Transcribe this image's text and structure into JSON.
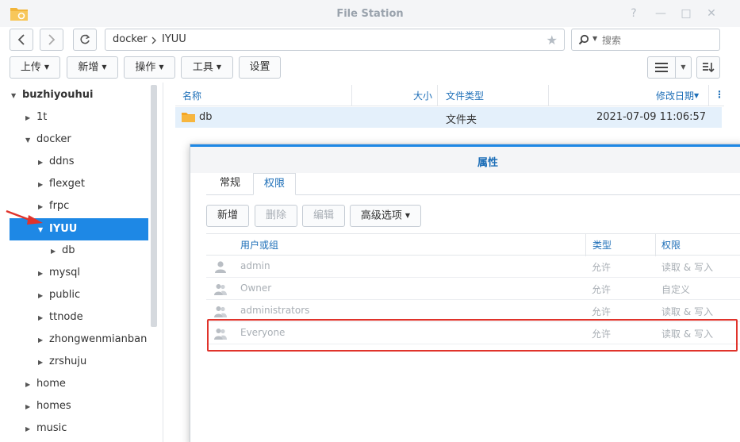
{
  "window": {
    "title": "File Station",
    "controls": [
      "?",
      "—",
      "□",
      "✕"
    ]
  },
  "path": {
    "segments": [
      "docker",
      "IYUU"
    ]
  },
  "search": {
    "placeholder": "搜索"
  },
  "toolbar": {
    "upload": "上传",
    "new": "新增",
    "action": "操作",
    "tools": "工具",
    "settings": "设置"
  },
  "tree": {
    "root": "buzhiyouhui",
    "items": [
      {
        "label": "1t"
      },
      {
        "label": "docker"
      },
      {
        "label": "ddns"
      },
      {
        "label": "flexget"
      },
      {
        "label": "frpc"
      },
      {
        "label": "IYUU"
      },
      {
        "label": "db"
      },
      {
        "label": "mysql"
      },
      {
        "label": "public"
      },
      {
        "label": "ttnode"
      },
      {
        "label": "zhongwenmianban"
      },
      {
        "label": "zrshuju"
      },
      {
        "label": "home"
      },
      {
        "label": "homes"
      },
      {
        "label": "music"
      }
    ]
  },
  "file_list": {
    "columns": {
      "name": "名称",
      "size": "大小",
      "type": "文件类型",
      "modified": "修改日期"
    },
    "rows": [
      {
        "name": "db",
        "size": "",
        "type": "文件夹",
        "modified": "2021-07-09 11:06:57"
      }
    ]
  },
  "dialog": {
    "title": "属性",
    "tabs": [
      "常规",
      "权限"
    ],
    "active_tab": "权限",
    "buttons": {
      "add": "新增",
      "delete": "删除",
      "edit": "编辑",
      "advanced": "高级选项"
    },
    "columns": {
      "user": "用户或组",
      "type": "类型",
      "permission": "权限"
    },
    "rows": [
      {
        "user": "admin",
        "type": "允许",
        "permission": "读取 & 写入"
      },
      {
        "user": "Owner",
        "type": "允许",
        "permission": "自定义"
      },
      {
        "user": "administrators",
        "type": "允许",
        "permission": "读取 & 写入"
      },
      {
        "user": "Everyone",
        "type": "允许",
        "permission": "读取 & 写入"
      }
    ]
  },
  "colors": {
    "accent": "#1e88e5",
    "highlight": "#e0332b",
    "folder": "#f5a623"
  }
}
